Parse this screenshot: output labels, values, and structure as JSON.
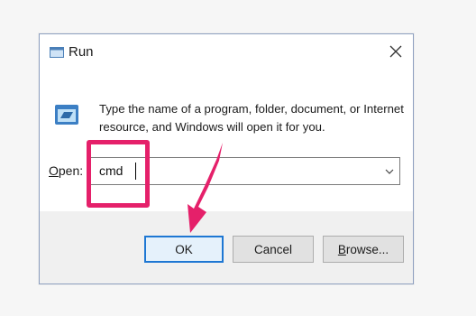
{
  "window": {
    "title": "Run",
    "icon": "run-icon",
    "close_icon": "close-icon"
  },
  "description": "Type the name of a program, folder, document, or Internet resource, and Windows will open it for you.",
  "open_field": {
    "label_accesskey": "O",
    "label_rest": "pen:",
    "value": "cmd",
    "dropdown_icon": "chevron-down-icon"
  },
  "buttons": {
    "ok": "OK",
    "cancel": "Cancel",
    "browse_accesskey": "B",
    "browse_rest": "rowse..."
  },
  "annotation": {
    "highlight_color": "#e5206a",
    "arrow_color": "#e5206a"
  },
  "colors": {
    "dialog_border": "#8ea0c0",
    "ok_border": "#1e77d3",
    "footer_bg": "#f0f0f0"
  }
}
